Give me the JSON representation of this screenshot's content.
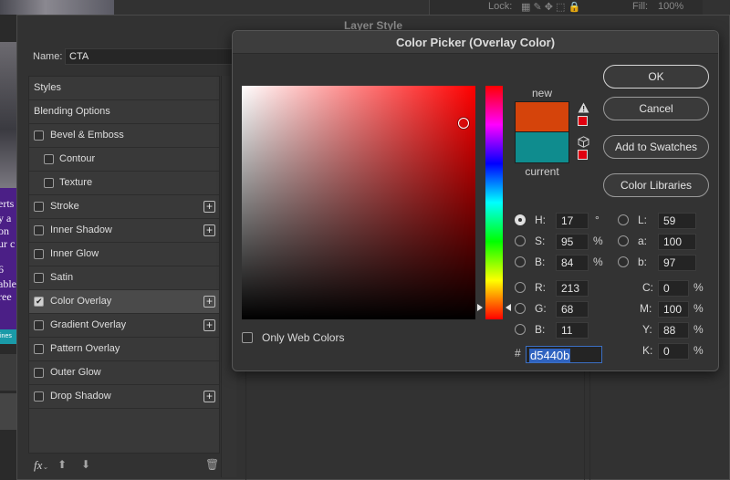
{
  "background": {
    "options_bar": {
      "lock_label": "Lock:",
      "fill_label": "Fill:",
      "fill_value": "100%"
    },
    "canvas_text_lines": [
      "erts",
      "y a",
      "on",
      "ur c",
      "6",
      "able",
      "ree"
    ],
    "canvas_banner_text": "ines"
  },
  "layer_style": {
    "title": "Layer Style",
    "name_label": "Name:",
    "name_value": "CTA",
    "list": [
      {
        "label": "Styles",
        "type": "header"
      },
      {
        "label": "Blending Options",
        "type": "header"
      },
      {
        "label": "Bevel & Emboss",
        "checked": false,
        "plus": false,
        "sub": false
      },
      {
        "label": "Contour",
        "checked": false,
        "plus": false,
        "sub": true
      },
      {
        "label": "Texture",
        "checked": false,
        "plus": false,
        "sub": true
      },
      {
        "label": "Stroke",
        "checked": false,
        "plus": true,
        "sub": false
      },
      {
        "label": "Inner Shadow",
        "checked": false,
        "plus": true,
        "sub": false
      },
      {
        "label": "Inner Glow",
        "checked": false,
        "plus": false,
        "sub": false
      },
      {
        "label": "Satin",
        "checked": false,
        "plus": false,
        "sub": false
      },
      {
        "label": "Color Overlay",
        "checked": true,
        "plus": true,
        "sub": false,
        "selected": true
      },
      {
        "label": "Gradient Overlay",
        "checked": false,
        "plus": true,
        "sub": false
      },
      {
        "label": "Pattern Overlay",
        "checked": false,
        "plus": false,
        "sub": false
      },
      {
        "label": "Outer Glow",
        "checked": false,
        "plus": false,
        "sub": false
      },
      {
        "label": "Drop Shadow",
        "checked": false,
        "plus": true,
        "sub": false
      }
    ],
    "bottom_icons": [
      "fx-icon",
      "arrow-up-icon",
      "arrow-down-icon",
      "trash-icon"
    ]
  },
  "color_picker": {
    "title": "Color Picker (Overlay Color)",
    "new_label": "new",
    "current_label": "current",
    "new_color": "#d5440b",
    "current_color": "#0f8c8e",
    "buttons": {
      "ok": "OK",
      "cancel": "Cancel",
      "add_to_swatches": "Add to Swatches",
      "color_libraries": "Color Libraries"
    },
    "only_web_colors": {
      "label": "Only Web Colors",
      "checked": false
    },
    "hsb": {
      "h": {
        "label": "H:",
        "value": "17",
        "unit": "°",
        "selected": true
      },
      "s": {
        "label": "S:",
        "value": "95",
        "unit": "%",
        "selected": false
      },
      "b": {
        "label": "B:",
        "value": "84",
        "unit": "%",
        "selected": false
      }
    },
    "rgb": {
      "r": {
        "label": "R:",
        "value": "213"
      },
      "g": {
        "label": "G:",
        "value": "68"
      },
      "b": {
        "label": "B:",
        "value": "11"
      }
    },
    "lab": {
      "l": {
        "label": "L:",
        "value": "59"
      },
      "a": {
        "label": "a:",
        "value": "100"
      },
      "b": {
        "label": "b:",
        "value": "97"
      }
    },
    "cmyk": {
      "c": {
        "label": "C:",
        "value": "0",
        "unit": "%"
      },
      "m": {
        "label": "M:",
        "value": "100",
        "unit": "%"
      },
      "y": {
        "label": "Y:",
        "value": "88",
        "unit": "%"
      },
      "k": {
        "label": "K:",
        "value": "0",
        "unit": "%"
      }
    },
    "hex_label": "#",
    "hex_value": "d5440b",
    "field_hue_color": "#ff0000",
    "gamut_color": "#e0000f",
    "websafe_color": "#e00010",
    "saturation_pick": 0.95,
    "brightness_pick": 0.84
  }
}
